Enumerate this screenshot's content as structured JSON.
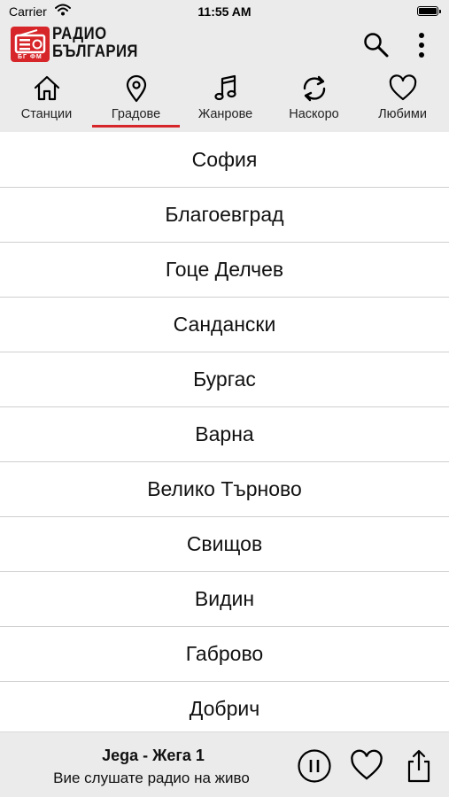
{
  "status_bar": {
    "carrier": "Carrier",
    "time": "11:55 AM",
    "battery_level": 1.0
  },
  "header": {
    "logo_line1": "РАДИО",
    "logo_line2": "БЪЛГАРИЯ",
    "logo_badge": "БГ ФМ",
    "brand_color": "#d7262a",
    "search_icon": "search-icon",
    "more_icon": "more-vertical-icon"
  },
  "tabs": [
    {
      "label": "Станции",
      "icon": "home-icon",
      "selected": false
    },
    {
      "label": "Градове",
      "icon": "location-pin-icon",
      "selected": true
    },
    {
      "label": "Жанрове",
      "icon": "music-note-icon",
      "selected": false
    },
    {
      "label": "Наскоро",
      "icon": "refresh-icon",
      "selected": false
    },
    {
      "label": "Любими",
      "icon": "heart-icon",
      "selected": false
    }
  ],
  "cities": [
    "София",
    "Благоевград",
    "Гоце Делчев",
    "Сандански",
    "Бургас",
    "Варна",
    "Велико Търново",
    "Свищов",
    "Видин",
    "Габрово",
    "Добрич"
  ],
  "player": {
    "now_playing": "Jega - Жега 1",
    "subtitle": "Вие слушате радио на живо",
    "pause_icon": "pause-circle-icon",
    "favorite_icon": "heart-icon",
    "share_icon": "share-icon"
  }
}
